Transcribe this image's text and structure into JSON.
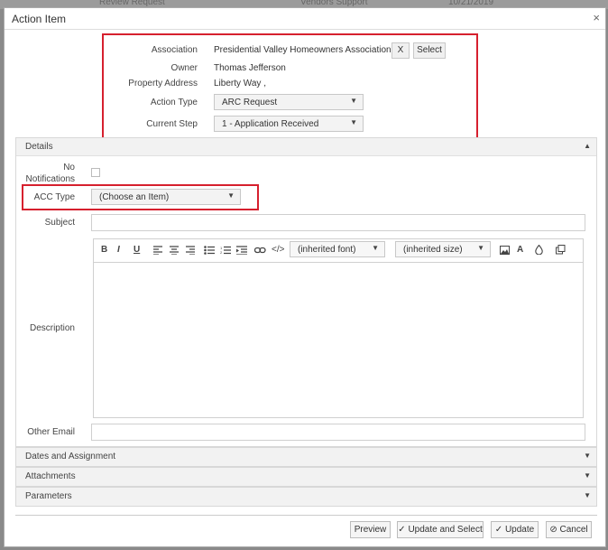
{
  "background": {
    "row_texts": [
      "Review Request",
      "Vendors Support",
      "10/21/2019"
    ]
  },
  "dialog": {
    "title": "Action Item",
    "close_glyph": "×"
  },
  "header_fields": {
    "association_label": "Association",
    "association_value": "Presidential Valley Homeowners Association",
    "clear_button": "X",
    "select_button": "Select",
    "owner_label": "Owner",
    "owner_value": "Thomas Jefferson",
    "property_address_label": "Property Address",
    "property_address_value": "Liberty Way ,",
    "action_type_label": "Action Type",
    "action_type_value": "ARC Request",
    "current_step_label": "Current Step",
    "current_step_value": "1 - Application Received"
  },
  "details": {
    "title": "Details",
    "no_notifications_label_1": "No",
    "no_notifications_label_2": "Notifications",
    "acc_type_label": "ACC Type",
    "acc_type_value": "(Choose an Item)",
    "subject_label": "Subject",
    "subject_value": "",
    "description_label": "Description",
    "other_email_label": "Other Email",
    "other_email_value": "",
    "toolbar": {
      "bold": "B",
      "italic": "I",
      "underline": "U",
      "font_select": "(inherited font)",
      "size_select": "(inherited size)",
      "text_color": "A"
    }
  },
  "sections": [
    {
      "title": "Dates and Assignment"
    },
    {
      "title": "Attachments"
    },
    {
      "title": "Parameters"
    }
  ],
  "footer": {
    "preview": "Preview",
    "update_and_select": "Update and Select",
    "update": "Update",
    "cancel": "Cancel"
  },
  "colors": {
    "highlight": "#d6202e",
    "panel_header": "#f2f2f2"
  }
}
